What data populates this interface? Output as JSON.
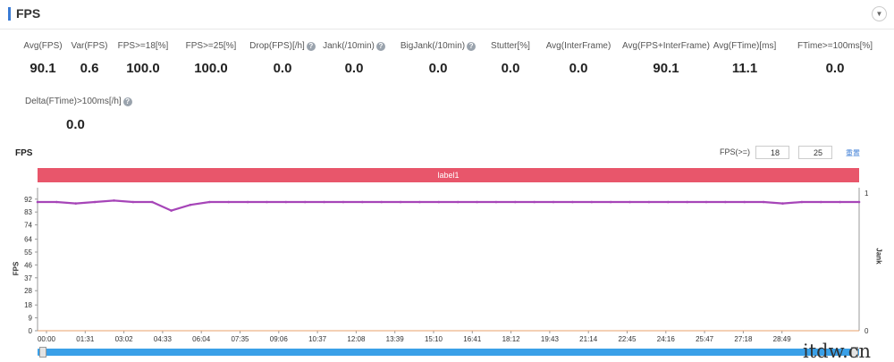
{
  "header": {
    "title": "FPS"
  },
  "metrics": [
    {
      "label": "Avg(FPS)",
      "value": "90.1",
      "help": false
    },
    {
      "label": "Var(FPS)",
      "value": "0.6",
      "help": false
    },
    {
      "label": "FPS>=18[%]",
      "value": "100.0",
      "help": false
    },
    {
      "label": "FPS>=25[%]",
      "value": "100.0",
      "help": false
    },
    {
      "label": "Drop(FPS)[/h]",
      "value": "0.0",
      "help": true
    },
    {
      "label": "Jank(/10min)",
      "value": "0.0",
      "help": true
    },
    {
      "label": "BigJank(/10min)",
      "value": "0.0",
      "help": true
    },
    {
      "label": "Stutter[%]",
      "value": "0.0",
      "help": false
    },
    {
      "label": "Avg(InterFrame)",
      "value": "0.0",
      "help": false
    },
    {
      "label": "Avg(FPS+InterFrame)",
      "value": "90.1",
      "help": false
    },
    {
      "label": "Avg(FTime)[ms]",
      "value": "11.1",
      "help": false
    },
    {
      "label": "FTime>=100ms[%]",
      "value": "0.0",
      "help": false
    }
  ],
  "metric_delta": {
    "label": "Delta(FTime)>100ms[/h]",
    "value": "0.0",
    "help": true
  },
  "chart_controls": {
    "title": "FPS",
    "threshold_label": "FPS(>=)",
    "threshold_low": "18",
    "threshold_high": "25",
    "reset_label": "重置"
  },
  "chart_data": {
    "type": "line",
    "band_label": "label1",
    "ylabel": "FPS",
    "ylabel_right": "Jank",
    "y_ticks": [
      "0",
      "9",
      "18",
      "28",
      "37",
      "46",
      "55",
      "64",
      "74",
      "83",
      "92"
    ],
    "y_right_ticks": [
      "0",
      "1"
    ],
    "ylim": [
      0,
      100
    ],
    "x_ticks": [
      "00:00",
      "01:31",
      "03:02",
      "04:33",
      "06:04",
      "07:35",
      "09:06",
      "10:37",
      "12:08",
      "13:39",
      "15:10",
      "16:41",
      "18:12",
      "19:43",
      "21:14",
      "22:45",
      "24:16",
      "25:47",
      "27:18",
      "28:49"
    ],
    "series": [
      {
        "values": [
          90,
          90,
          89,
          90,
          91,
          90,
          90,
          84,
          88,
          90,
          90,
          90,
          90,
          90,
          90,
          90,
          90,
          90,
          90,
          90,
          90,
          90,
          90,
          90,
          90,
          90,
          90,
          90,
          90,
          90,
          90,
          90,
          90,
          90,
          90,
          90,
          90,
          90,
          90,
          89,
          90,
          90,
          90,
          90
        ],
        "color": "#a645b8"
      },
      {
        "values": [
          0,
          0,
          0,
          0,
          0,
          0,
          0,
          0,
          0,
          0,
          0,
          0,
          0,
          0,
          0,
          0,
          0,
          0,
          0,
          0,
          0,
          0,
          0,
          0,
          0,
          0,
          0,
          0,
          0,
          0,
          0,
          0,
          0,
          0,
          0,
          0,
          0,
          0,
          0,
          0,
          0,
          0,
          0,
          0
        ],
        "color": "#e8a06b"
      }
    ]
  },
  "watermark": "itdw.cn"
}
